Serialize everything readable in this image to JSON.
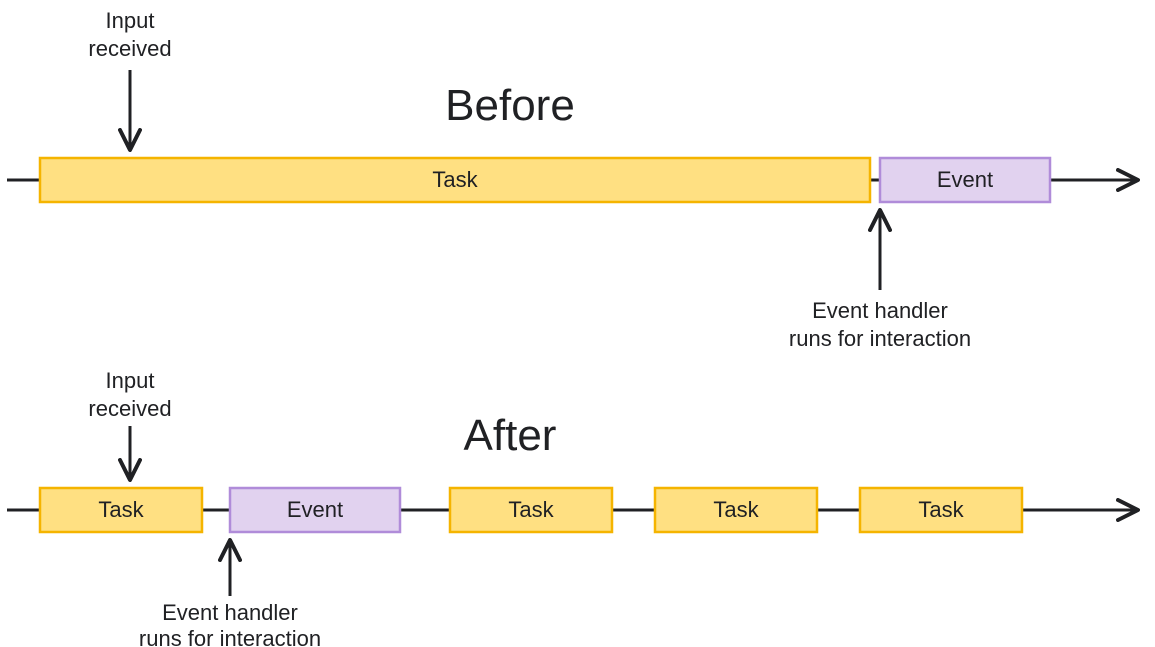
{
  "before": {
    "title": "Before",
    "input_label_l1": "Input",
    "input_label_l2": "received",
    "handler_label_l1": "Event handler",
    "handler_label_l2": "runs for interaction",
    "task_label": "Task",
    "event_label": "Event"
  },
  "after": {
    "title": "After",
    "input_label_l1": "Input",
    "input_label_l2": "received",
    "handler_label_l1": "Event handler",
    "handler_label_l2": "runs for interaction",
    "task1_label": "Task",
    "event_label": "Event",
    "task2_label": "Task",
    "task3_label": "Task",
    "task4_label": "Task"
  }
}
